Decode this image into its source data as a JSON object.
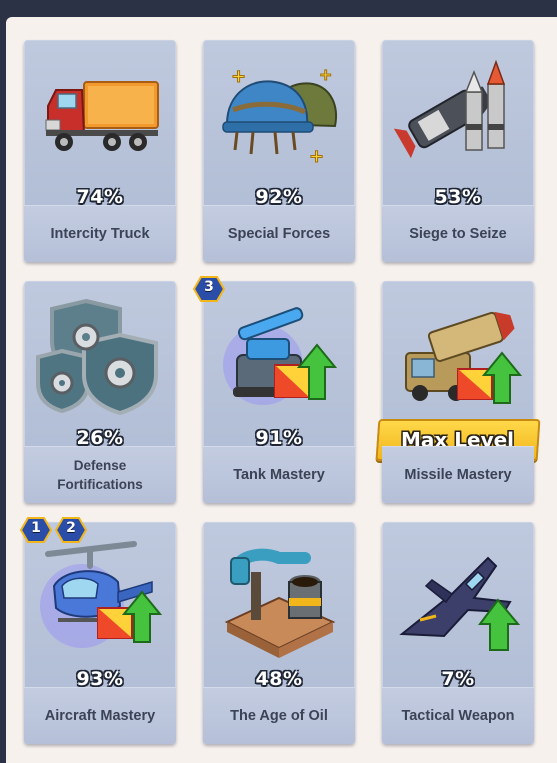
{
  "cards": [
    {
      "name": "Intercity Truck",
      "percent": "74%"
    },
    {
      "name": "Special Forces",
      "percent": "92%"
    },
    {
      "name": "Siege to Seize",
      "percent": "53%"
    },
    {
      "name": "Defense Fortifications",
      "name_line1": "Defense",
      "name_line2": "Fortifications",
      "percent": "26%"
    },
    {
      "name": "Tank Mastery",
      "percent": "91%",
      "badges": [
        "3"
      ]
    },
    {
      "name": "Missile Mastery",
      "max_label": "Max Level"
    },
    {
      "name": "Aircraft Mastery",
      "percent": "93%",
      "badges": [
        "1",
        "2"
      ]
    },
    {
      "name": "The Age of Oil",
      "percent": "48%"
    },
    {
      "name": "Tactical Weapon",
      "percent": "7%"
    }
  ],
  "icons": [
    "truck-icon",
    "helmets-icon",
    "missiles-icon",
    "shields-gear-icon",
    "tank-upgrade-icon",
    "missile-launcher-upgrade-icon",
    "helicopter-upgrade-icon",
    "oil-pump-icon",
    "jet-fighter-icon"
  ],
  "colors": {
    "card_bg": "#b8c3d9",
    "badge": "#f2b61a",
    "upgrade_arrow": "#3fbf3a"
  }
}
